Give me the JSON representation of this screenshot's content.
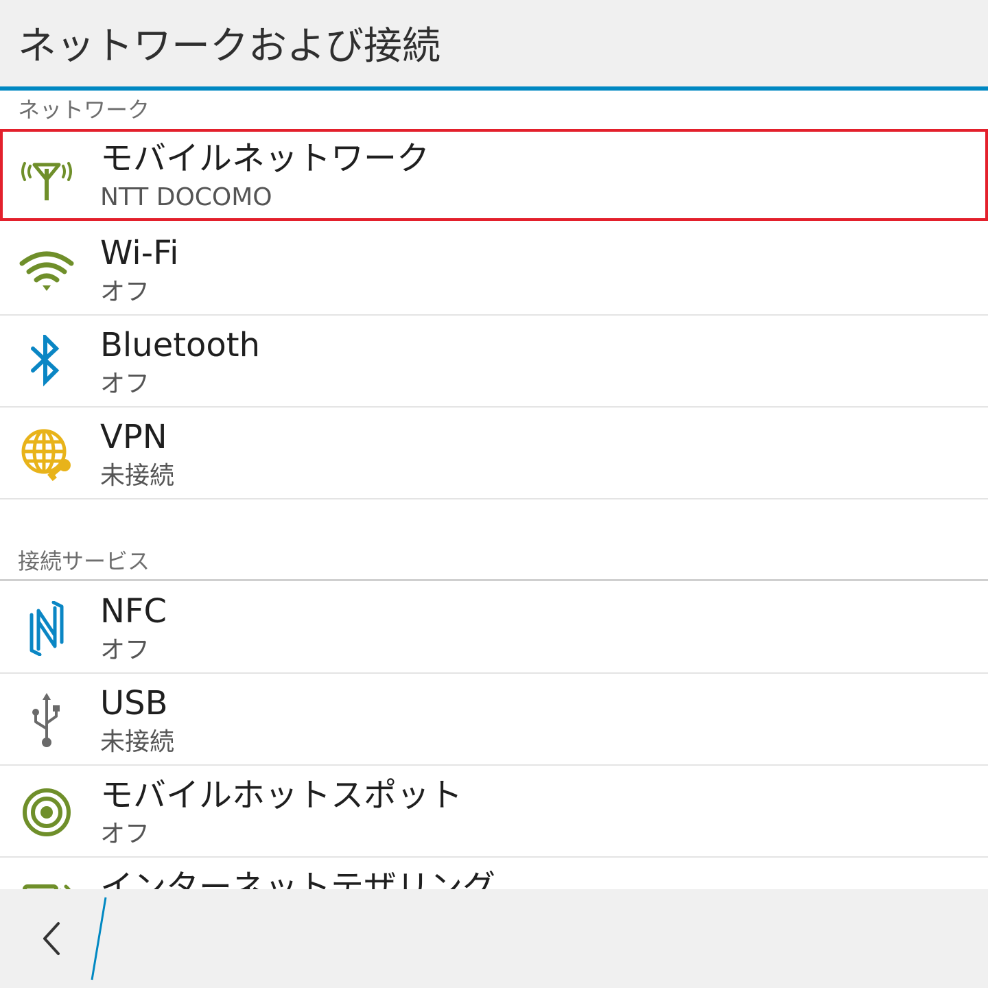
{
  "header": {
    "title": "ネットワークおよび接続"
  },
  "sections": {
    "network": {
      "label": "ネットワーク"
    },
    "services": {
      "label": "接続サービス"
    }
  },
  "rows": {
    "mobile_network": {
      "title": "モバイルネットワーク",
      "subtitle": "NTT DOCOMO",
      "icon": "antenna-icon",
      "highlighted": true
    },
    "wifi": {
      "title": "Wi-Fi",
      "subtitle": "オフ",
      "icon": "wifi-icon"
    },
    "bluetooth": {
      "title": "Bluetooth",
      "subtitle": "オフ",
      "icon": "bluetooth-icon"
    },
    "vpn": {
      "title": "VPN",
      "subtitle": "未接続",
      "icon": "globe-key-icon"
    },
    "nfc": {
      "title": "NFC",
      "subtitle": "オフ",
      "icon": "nfc-icon"
    },
    "usb": {
      "title": "USB",
      "subtitle": "未接続",
      "icon": "usb-icon"
    },
    "hotspot": {
      "title": "モバイルホットスポット",
      "subtitle": "オフ",
      "icon": "hotspot-icon"
    },
    "tethering": {
      "title": "インターネットテザリング",
      "icon": "tethering-icon"
    }
  },
  "colors": {
    "accent": "#0088c2",
    "highlight_border": "#e3202c",
    "icon_green": "#6f8f2a",
    "icon_blue": "#0a86c4",
    "icon_yellow": "#e8b31a",
    "icon_gray": "#6a6a6a"
  },
  "bottom_bar": {
    "back_icon": "chevron-left-icon"
  }
}
